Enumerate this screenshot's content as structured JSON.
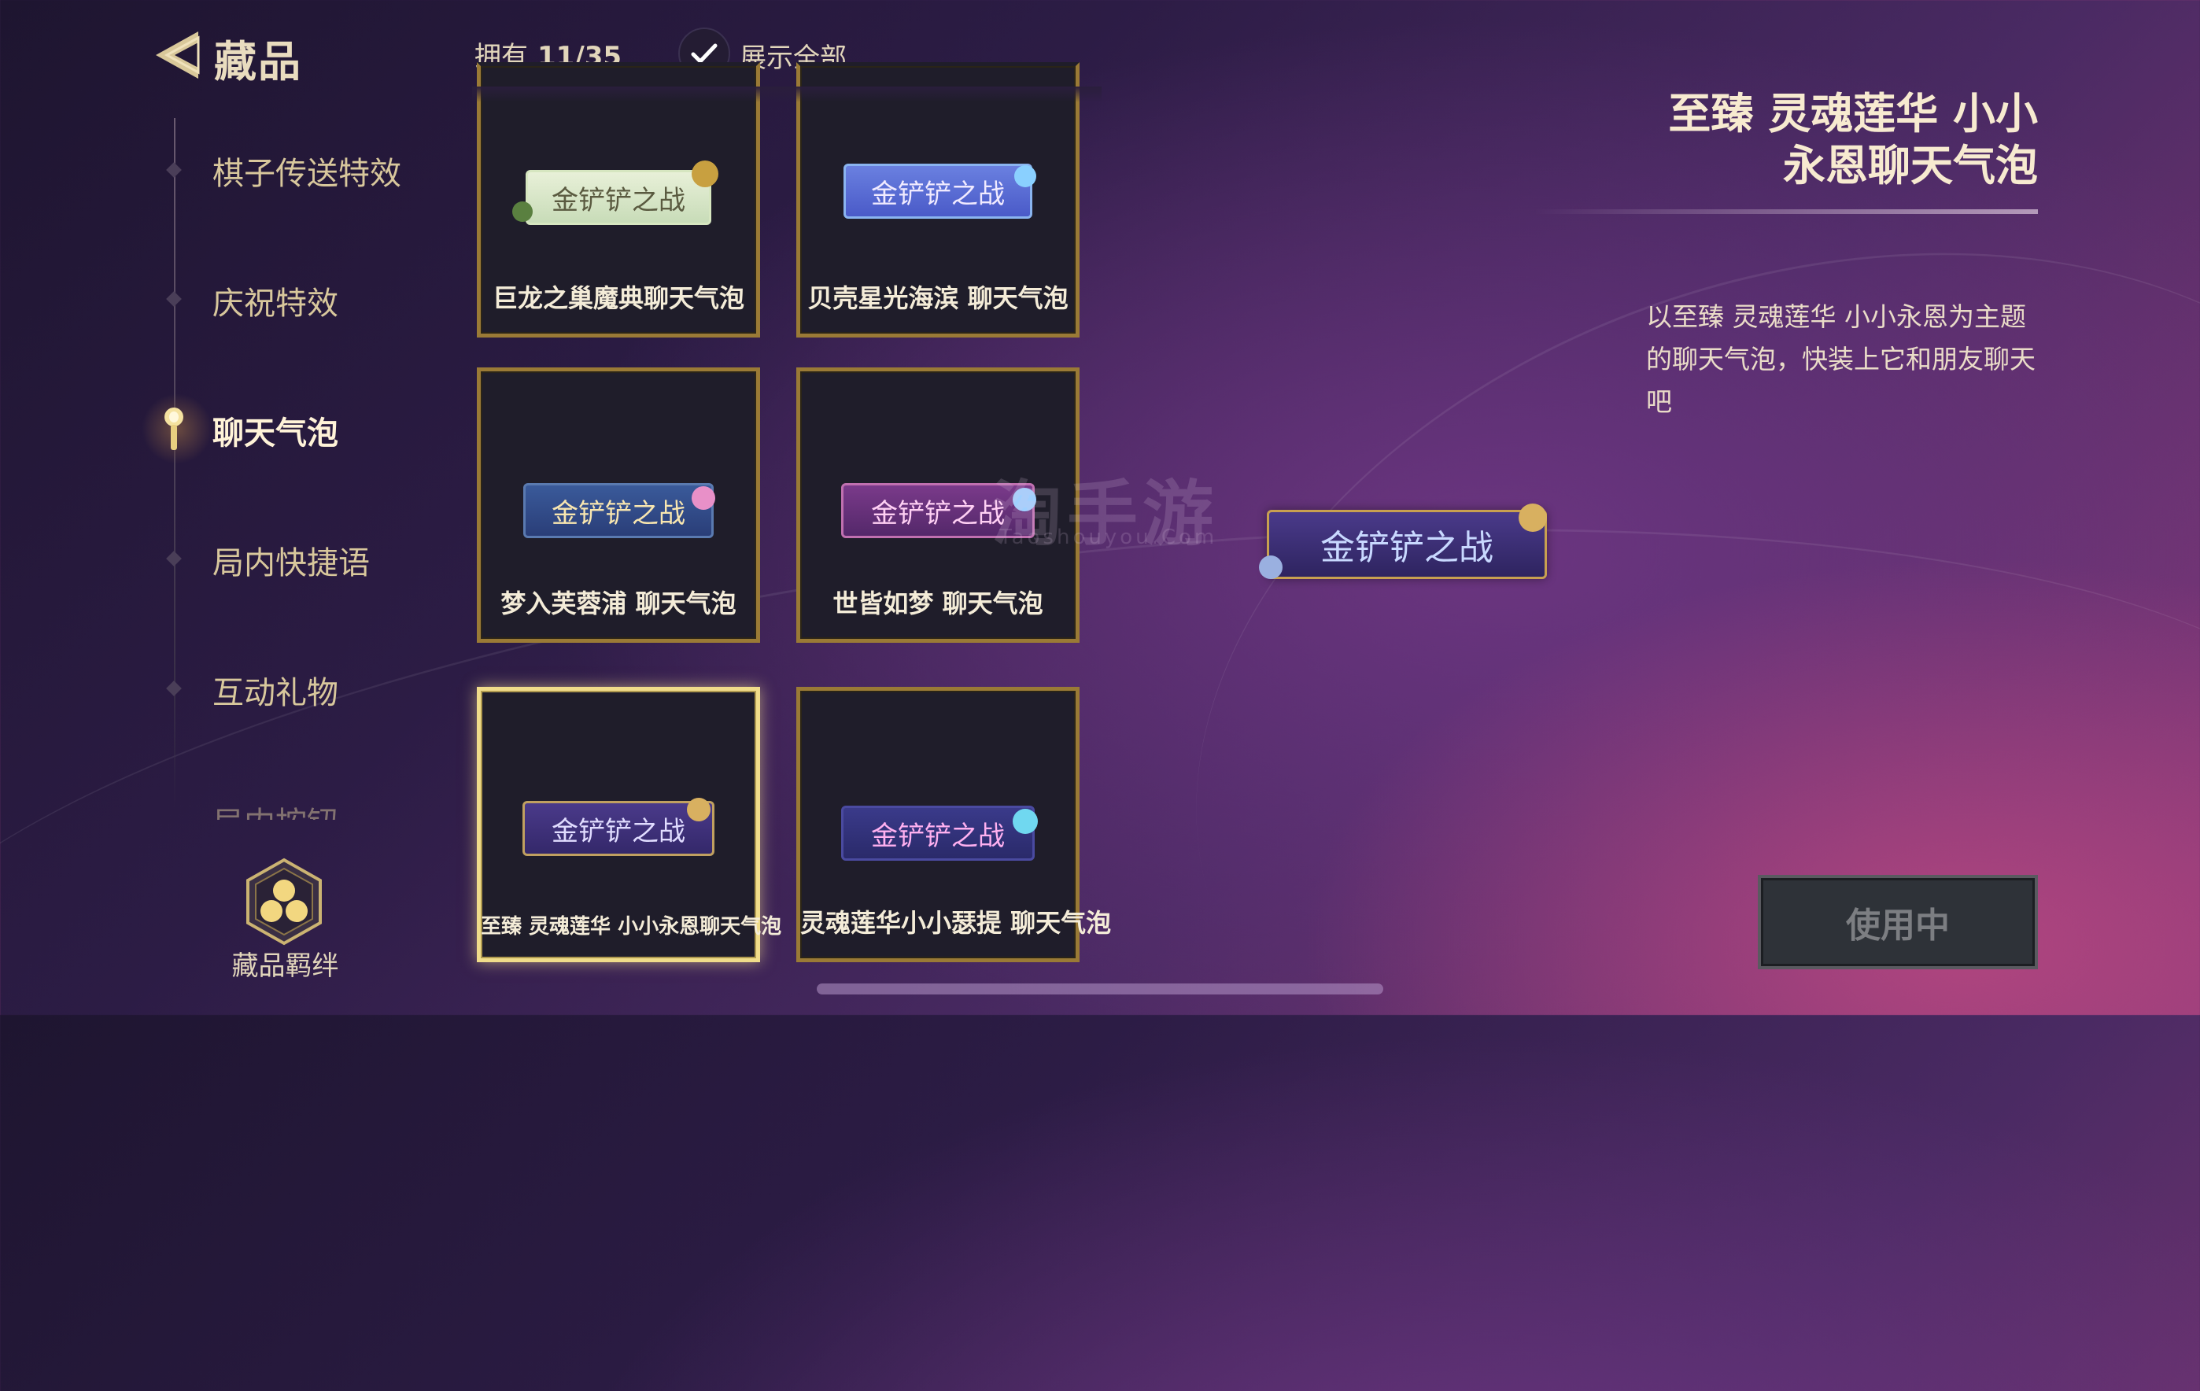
{
  "header": {
    "title": "藏品",
    "owned_label": "拥有",
    "owned_count": "11/35",
    "show_all_label": "展示全部",
    "show_all_checked": true
  },
  "sidebar": {
    "items": [
      {
        "label": "棋子传送特效",
        "active": false
      },
      {
        "label": "庆祝特效",
        "active": false
      },
      {
        "label": "聊天气泡",
        "active": true
      },
      {
        "label": "局内快捷语",
        "active": false
      },
      {
        "label": "互动礼物",
        "active": false
      },
      {
        "label": "局内按钮",
        "active": false
      }
    ],
    "bond_button_label": "藏品羁绊"
  },
  "grid": {
    "bubble_text": "金铲铲之战",
    "cards": [
      {
        "name": "巨龙之巢魔典聊天气泡",
        "style": "green",
        "selected": false
      },
      {
        "name": "贝壳星光海滨 聊天气泡",
        "style": "blue",
        "selected": false
      },
      {
        "name": "梦入芙蓉浦 聊天气泡",
        "style": "navy",
        "selected": false
      },
      {
        "name": "世皆如梦 聊天气泡",
        "style": "purple",
        "selected": false
      },
      {
        "name": "至臻 灵魂莲华 小小永恩聊天气泡",
        "style": "violet",
        "selected": true
      },
      {
        "name": "灵魂莲华小小瑟提 聊天气泡",
        "style": "indigo",
        "selected": false
      }
    ]
  },
  "preview": {
    "bubble_text": "金铲铲之战",
    "title_line1": "至臻 灵魂莲华 小小",
    "title_line2": "永恩聊天气泡",
    "description": "以至臻 灵魂莲华 小小永恩为主题的聊天气泡，快装上它和朋友聊天吧",
    "use_button_label": "使用中"
  },
  "watermark": {
    "text": "淘手游",
    "sub": "Taoshouyou.Com"
  },
  "colors": {
    "gold_border": "#9a7a36",
    "selected_border": "#f0dc8a",
    "accent_text": "#e9dcbf"
  }
}
